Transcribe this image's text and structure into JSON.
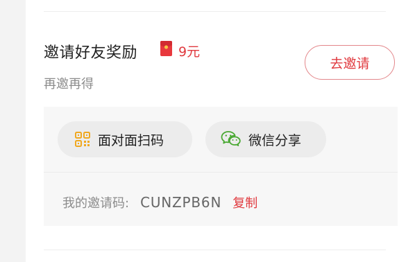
{
  "invite": {
    "title": "邀请好友奖励",
    "reward_icon": "red-packet-icon",
    "reward_amount": "9元",
    "subtitle": "再邀再得",
    "invite_button": "去邀请"
  },
  "share": {
    "face_to_face": {
      "icon": "qr-code-icon",
      "label": "面对面扫码"
    },
    "wechat": {
      "icon": "wechat-icon",
      "label": "微信分享"
    }
  },
  "invite_code": {
    "label": "我的邀请码:",
    "value": "CUNZPB6N",
    "copy_label": "复制"
  },
  "colors": {
    "accent": "#e0393e",
    "qr_icon": "#f0a820",
    "wechat_icon": "#49a832",
    "panel_bg": "#f7f7f7"
  }
}
